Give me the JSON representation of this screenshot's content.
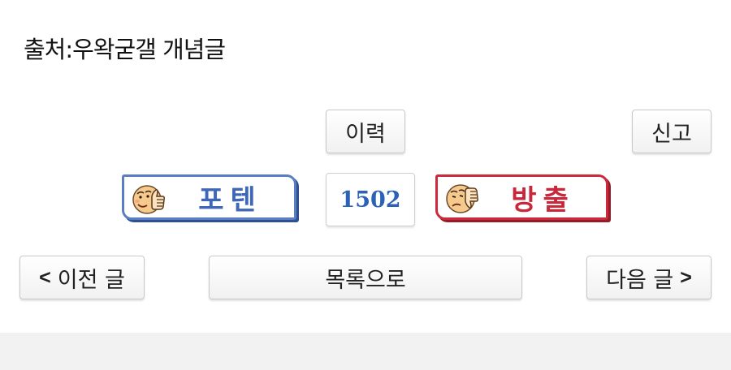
{
  "source": {
    "text": "출처:우왁굳갤 개념글"
  },
  "buttons": {
    "history": "이력",
    "report": "신고",
    "list": "목록으로",
    "prev_arrow": "<",
    "prev_label": "이전 글",
    "next_label": "다음 글",
    "next_arrow": ">"
  },
  "votes": {
    "up_label": "포텐",
    "down_label": "방출",
    "count": "1502",
    "up_icon": "thumbs-up-face-icon",
    "down_icon": "thumbs-down-face-icon",
    "up_color": "#3f67b8",
    "down_color": "#c8283a",
    "count_color": "#2a62b8"
  }
}
